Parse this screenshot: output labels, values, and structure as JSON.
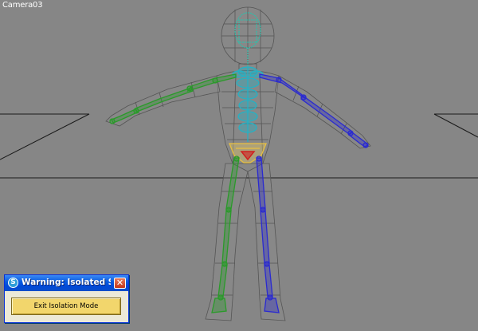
{
  "viewport": {
    "label": "Camera03",
    "background": "#868686",
    "model": {
      "mesh_color": "#555555",
      "spine_color": "#1fb4c8",
      "left_chain_color": "#2a9a2a",
      "right_chain_color": "#2a2ad0",
      "pelvis_color": "#f0d060",
      "root_color": "#d02020"
    }
  },
  "dialog": {
    "title": "Warning: Isolated Sel...",
    "title_icon": "3ds-max-icon",
    "close_icon": "close-icon",
    "button_label": "Exit Isolation Mode",
    "button_color": "#f2d66c"
  }
}
